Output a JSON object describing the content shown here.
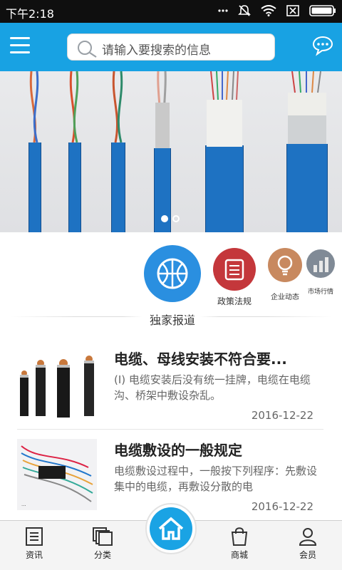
{
  "status": {
    "time": "下午2:18"
  },
  "search": {
    "placeholder": "请输入要搜索的信息"
  },
  "categories": [
    {
      "label": "独家报道",
      "color": "#2a8fe0",
      "icon": "basketball-icon"
    },
    {
      "label": "政策法规",
      "color": "#c4373b",
      "icon": "document-icon"
    },
    {
      "label": "企业动态",
      "color": "#c8895f",
      "icon": "lightbulb-icon"
    },
    {
      "label": "市场行情",
      "color": "#808a96",
      "icon": "chart-photo-icon"
    }
  ],
  "news": [
    {
      "title": "电缆、母线安装不符合要...",
      "body": "(Ⅰ) 电缆安装后没有统一挂牌，电缆在电缆沟、桥架中敷设杂乱。",
      "date": "2016-12-22"
    },
    {
      "title": "电缆敷设的一般规定",
      "body": "电缆敷设过程中，一般按下列程序：先敷设集中的电缆，再敷设分散的电",
      "date": "2016-12-22"
    }
  ],
  "tabs": [
    {
      "label": "资讯",
      "icon": "news-icon"
    },
    {
      "label": "分类",
      "icon": "category-icon"
    },
    {
      "label": "",
      "icon": "home-icon"
    },
    {
      "label": "商城",
      "icon": "shopping-bag-icon"
    },
    {
      "label": "会员",
      "icon": "member-icon"
    }
  ],
  "banner": {
    "slides": 2,
    "active": 1
  },
  "colors": {
    "accent": "#18a2e3",
    "statusbar": "#0f0f0f"
  }
}
